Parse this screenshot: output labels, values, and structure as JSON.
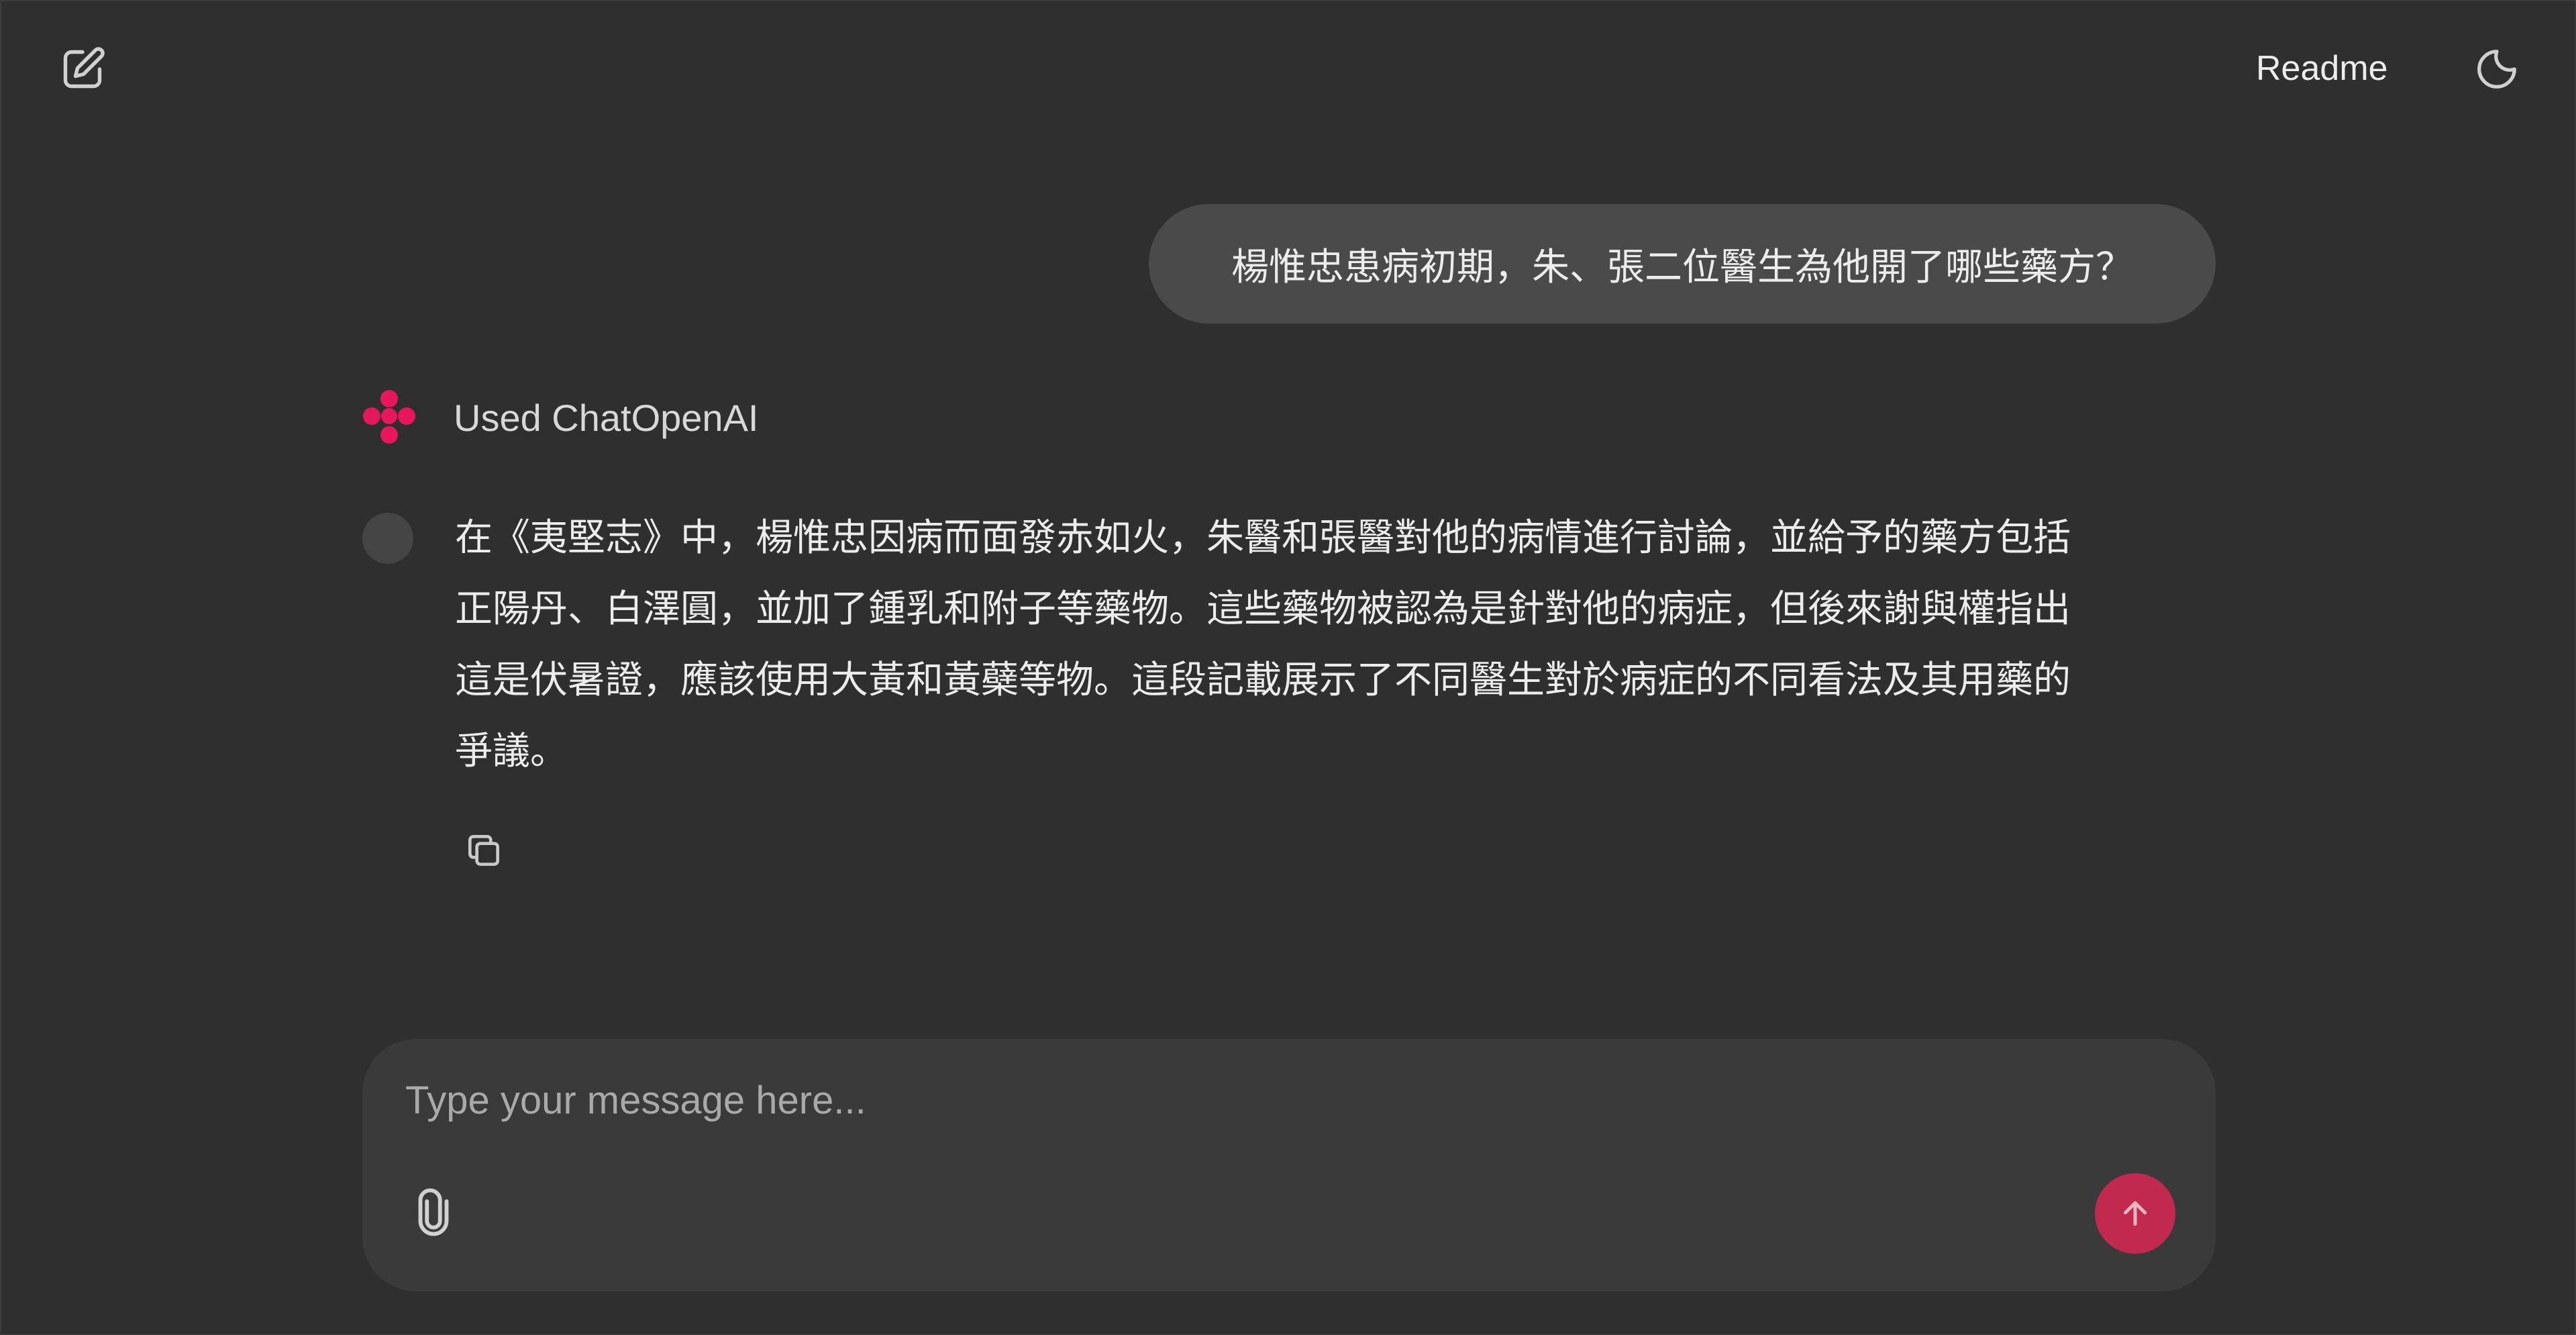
{
  "header": {
    "new_chat_icon": "edit-icon",
    "readme_label": "Readme",
    "theme_icon": "moon-icon"
  },
  "conversation": {
    "user_message": "楊惟忠患病初期，朱、張二位醫生為他開了哪些藥方？",
    "tool_label": "Used ChatOpenAI",
    "answer_lines": [
      "在《夷堅志》中，楊惟忠因病而面發赤如火，朱醫和張醫對他的病情進行討論，並給予的藥方包括",
      "正陽丹、白澤圓，並加了鍾乳和附子等藥物。這些藥物被認為是針對他的病症，但後來謝與權指出",
      "這是伏暑證，應該使用大黃和黃蘗等物。這段記載展示了不同醫生對於病症的不同看法及其用藥的",
      "爭議。"
    ],
    "copy_icon": "copy-icon"
  },
  "composer": {
    "placeholder": "Type your message here...",
    "attach_icon": "paperclip-icon",
    "send_icon": "arrow-up-icon"
  },
  "colors": {
    "background": "#2f2f2f",
    "bubble": "#4a4a4a",
    "composer": "#3a3a3a",
    "accent": "#c2294f",
    "logo": "#e8175d"
  }
}
